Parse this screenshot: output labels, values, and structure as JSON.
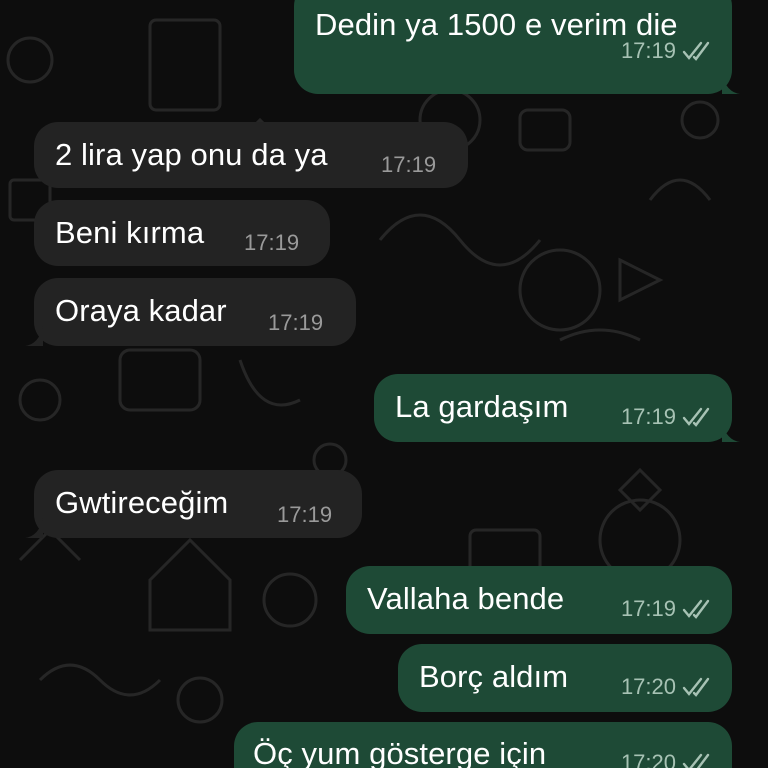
{
  "colors": {
    "background": "#0d0d0d",
    "incoming_bubble": "#232323",
    "outgoing_bubble": "#1e4a36",
    "text": "#ffffff",
    "time_incoming": "#9a9a9a",
    "time_outgoing": "#a7c2b4"
  },
  "messages": [
    {
      "direction": "outgoing",
      "text": "Dedin ya 1500 e verim die",
      "time": "17:19",
      "status_icon": "double-check-icon"
    },
    {
      "direction": "incoming",
      "text": "2 lira yap onu da ya",
      "time": "17:19"
    },
    {
      "direction": "incoming",
      "text": "Beni kırma",
      "time": "17:19"
    },
    {
      "direction": "incoming",
      "text": "Oraya kadar",
      "time": "17:19"
    },
    {
      "direction": "outgoing",
      "text": "La gardaşım",
      "time": "17:19",
      "status_icon": "double-check-icon"
    },
    {
      "direction": "incoming",
      "text": "Gwtireceğim",
      "time": "17:19"
    },
    {
      "direction": "outgoing",
      "text": "Vallaha bende",
      "time": "17:19",
      "status_icon": "double-check-icon"
    },
    {
      "direction": "outgoing",
      "text": "Borç aldım",
      "time": "17:20",
      "status_icon": "double-check-icon"
    },
    {
      "direction": "outgoing",
      "text": "Öç yum gösterge için",
      "time": "17:20",
      "status_icon": "double-check-icon"
    }
  ]
}
